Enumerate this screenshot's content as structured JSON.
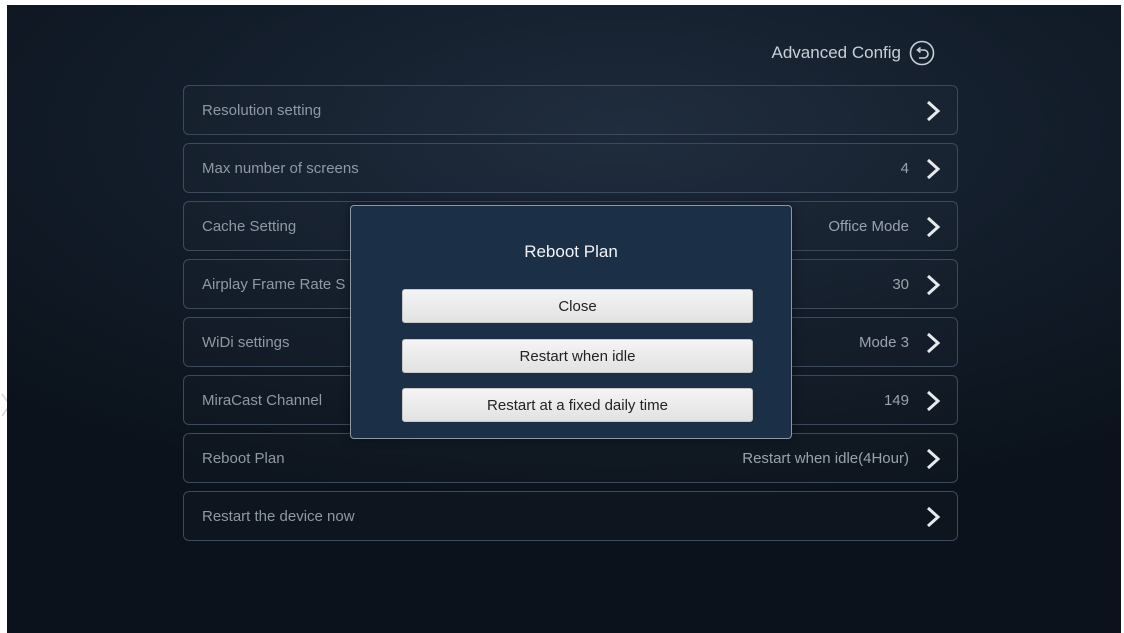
{
  "header": {
    "title": "Advanced Config",
    "back_icon": "back-arrow-circle-icon"
  },
  "rows": [
    {
      "label": "Resolution setting",
      "value": ""
    },
    {
      "label": "Max number of screens",
      "value": "4"
    },
    {
      "label": "Cache Setting",
      "value": "Office Mode"
    },
    {
      "label": "Airplay Frame Rate S",
      "value": "30"
    },
    {
      "label": "WiDi settings",
      "value": "Mode 3"
    },
    {
      "label": "MiraCast Channel",
      "value": "149"
    },
    {
      "label": "Reboot Plan",
      "value": "Restart when idle(4Hour)"
    },
    {
      "label": "Restart the device now",
      "value": ""
    }
  ],
  "dialog": {
    "title": "Reboot Plan",
    "options": [
      "Close",
      "Restart when idle",
      "Restart at a fixed daily time"
    ]
  },
  "colors": {
    "background": "#121c29",
    "dialog_background": "#1b2f47",
    "row_border": "#3c4a5b",
    "button_background": "#eeeeee"
  }
}
